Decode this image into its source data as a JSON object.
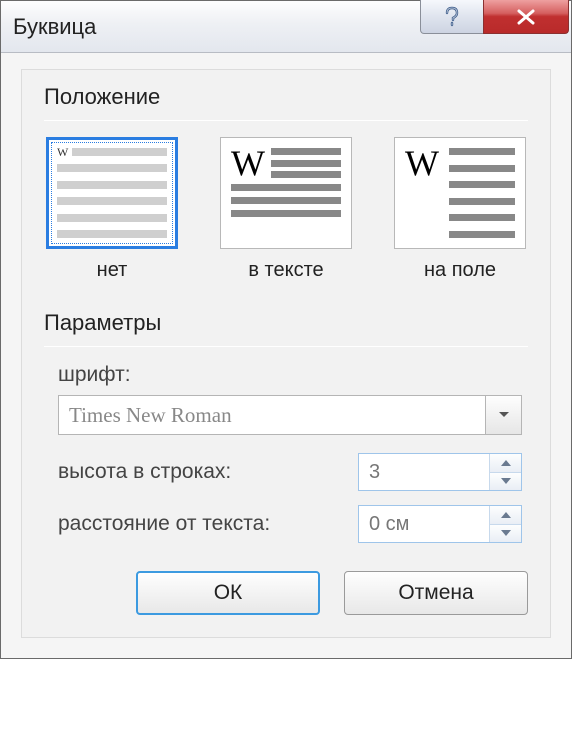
{
  "title": "Буквица",
  "group_position": "Положение",
  "options": {
    "none": "нет",
    "in_text": "в тексте",
    "in_margin": "на поле"
  },
  "group_params": "Параметры",
  "labels": {
    "font": "шрифт:",
    "height": "высота в строках:",
    "distance": "расстояние от текста:"
  },
  "values": {
    "font": "Times New Roman",
    "height": "3",
    "distance": "0 см"
  },
  "buttons": {
    "ok": "ОК",
    "cancel": "Отмена"
  }
}
